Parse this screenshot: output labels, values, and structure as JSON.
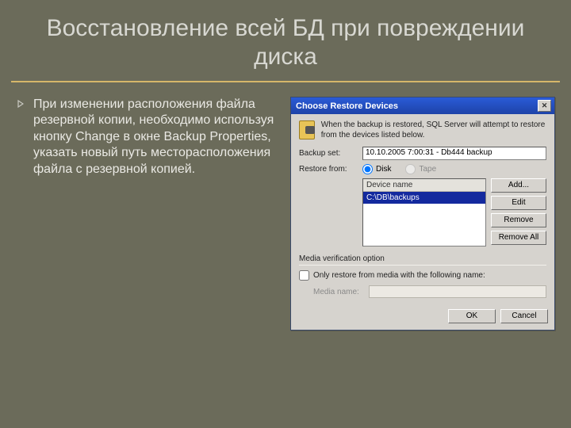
{
  "slide": {
    "title": "Восстановление всей БД при повреждении диска",
    "bullet": "При изменении расположения файла резервной копии, необходимо используя кнопку Change в окне Backup Properties, указать новый путь месторасположения файла с резервной копией."
  },
  "dialog": {
    "title": "Choose Restore Devices",
    "close": "✕",
    "hint": "When the backup is restored, SQL Server will attempt to restore from the devices listed below.",
    "backup_set_label": "Backup set:",
    "backup_set_value": "10.10.2005 7:00:31 - Db444 backup",
    "restore_from_label": "Restore from:",
    "radio_disk": "Disk",
    "radio_tape": "Tape",
    "list_header": "Device name",
    "list_item": "C:\\DB\\backups",
    "buttons": {
      "add": "Add...",
      "edit": "Edit",
      "remove": "Remove",
      "remove_all": "Remove All"
    },
    "media_section": "Media verification option",
    "only_restore": "Only restore from media with the following name:",
    "media_name_label": "Media name:",
    "ok": "OK",
    "cancel": "Cancel"
  }
}
